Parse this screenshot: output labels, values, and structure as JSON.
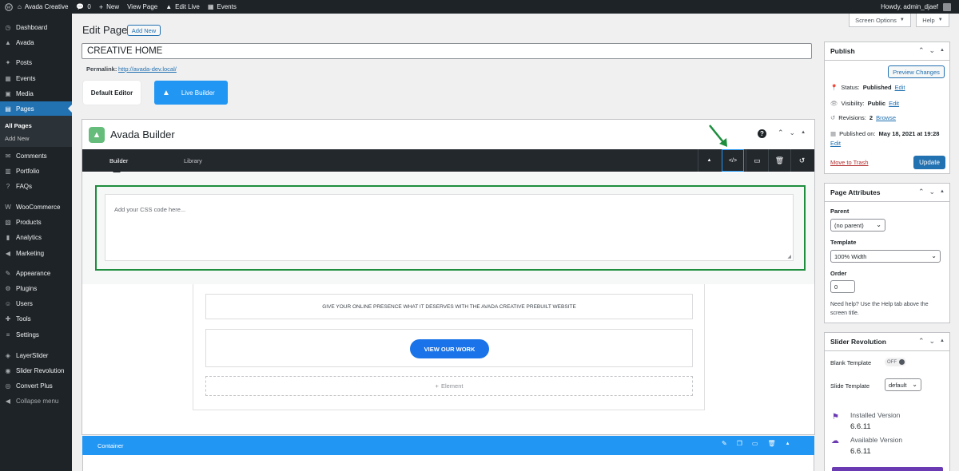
{
  "admin_bar": {
    "site_name": "Avada Creative",
    "comments_count": "0",
    "new_label": "New",
    "view_page": "View Page",
    "edit_live": "Edit Live",
    "events": "Events",
    "howdy": "Howdy, admin_djaef"
  },
  "sidebar": {
    "items": [
      {
        "label": "Dashboard",
        "icon": "dashboard-icon"
      },
      {
        "label": "Avada",
        "icon": "avada-icon"
      },
      {
        "label": "Posts",
        "icon": "pin-icon"
      },
      {
        "label": "Events",
        "icon": "calendar-icon"
      },
      {
        "label": "Media",
        "icon": "media-icon"
      },
      {
        "label": "Pages",
        "icon": "pages-icon"
      },
      {
        "label": "Comments",
        "icon": "comment-icon"
      },
      {
        "label": "Portfolio",
        "icon": "portfolio-icon"
      },
      {
        "label": "FAQs",
        "icon": "help-icon"
      },
      {
        "label": "WooCommerce",
        "icon": "woo-icon"
      },
      {
        "label": "Products",
        "icon": "products-icon"
      },
      {
        "label": "Analytics",
        "icon": "analytics-icon"
      },
      {
        "label": "Marketing",
        "icon": "megaphone-icon"
      },
      {
        "label": "Appearance",
        "icon": "brush-icon"
      },
      {
        "label": "Plugins",
        "icon": "plugin-icon"
      },
      {
        "label": "Users",
        "icon": "users-icon"
      },
      {
        "label": "Tools",
        "icon": "wrench-icon"
      },
      {
        "label": "Settings",
        "icon": "settings-icon"
      },
      {
        "label": "LayerSlider",
        "icon": "layers-icon"
      },
      {
        "label": "Slider Revolution",
        "icon": "slider-icon"
      },
      {
        "label": "Convert Plus",
        "icon": "convert-icon"
      },
      {
        "label": "Collapse menu",
        "icon": "collapse-icon"
      }
    ],
    "submenu": [
      "All Pages",
      "Add New"
    ]
  },
  "header": {
    "screen_options": "Screen Options",
    "help": "Help",
    "page_heading": "Edit Page",
    "add_new": "Add New"
  },
  "editor": {
    "title_value": "CREATIVE HOME",
    "permalink_label": "Permalink:",
    "permalink_url": "http://avada-dev.local/",
    "default_editor": "Default Editor",
    "live_builder": "Live Builder"
  },
  "builder": {
    "title": "Avada Builder",
    "tab_builder": "Builder",
    "tab_library": "Library",
    "css_placeholder": "Add your CSS code here...",
    "text_block": "GIVE YOUR ONLINE PRESENCE WHAT IT DESERVES WITH THE AVADA CREATIVE PREBUILT WEBSITE",
    "cta_button": "VIEW OUR WORK",
    "add_element": "Element",
    "container_label": "Container"
  },
  "publish": {
    "title": "Publish",
    "preview": "Preview Changes",
    "status_label": "Status:",
    "status_value": "Published",
    "visibility_label": "Visibility:",
    "visibility_value": "Public",
    "revisions_label": "Revisions:",
    "revisions_value": "2",
    "browse": "Browse",
    "published_label": "Published on:",
    "published_value": "May 18, 2021 at 19:28",
    "edit": "Edit",
    "trash": "Move to Trash",
    "update": "Update"
  },
  "attributes": {
    "title": "Page Attributes",
    "parent_label": "Parent",
    "parent_value": "(no parent)",
    "template_label": "Template",
    "template_value": "100% Width",
    "order_label": "Order",
    "order_value": "0",
    "help_text": "Need help? Use the Help tab above the screen title."
  },
  "slider_rev": {
    "title": "Slider Revolution",
    "blank_label": "Blank Template",
    "blank_value": "OFF",
    "slide_label": "Slide Template",
    "slide_value": "default",
    "installed_label": "Installed Version",
    "installed_value": "6.6.11",
    "available_label": "Available Version",
    "available_value": "6.6.11"
  },
  "colors": {
    "accent": "#2271b1",
    "builder_blue": "#2196f3",
    "highlight_green": "#1e8e3e",
    "dark_bar": "#23282d",
    "avada_green": "#65bc7b",
    "cta_blue": "#1a73e8",
    "purple": "#6a3ab2"
  }
}
